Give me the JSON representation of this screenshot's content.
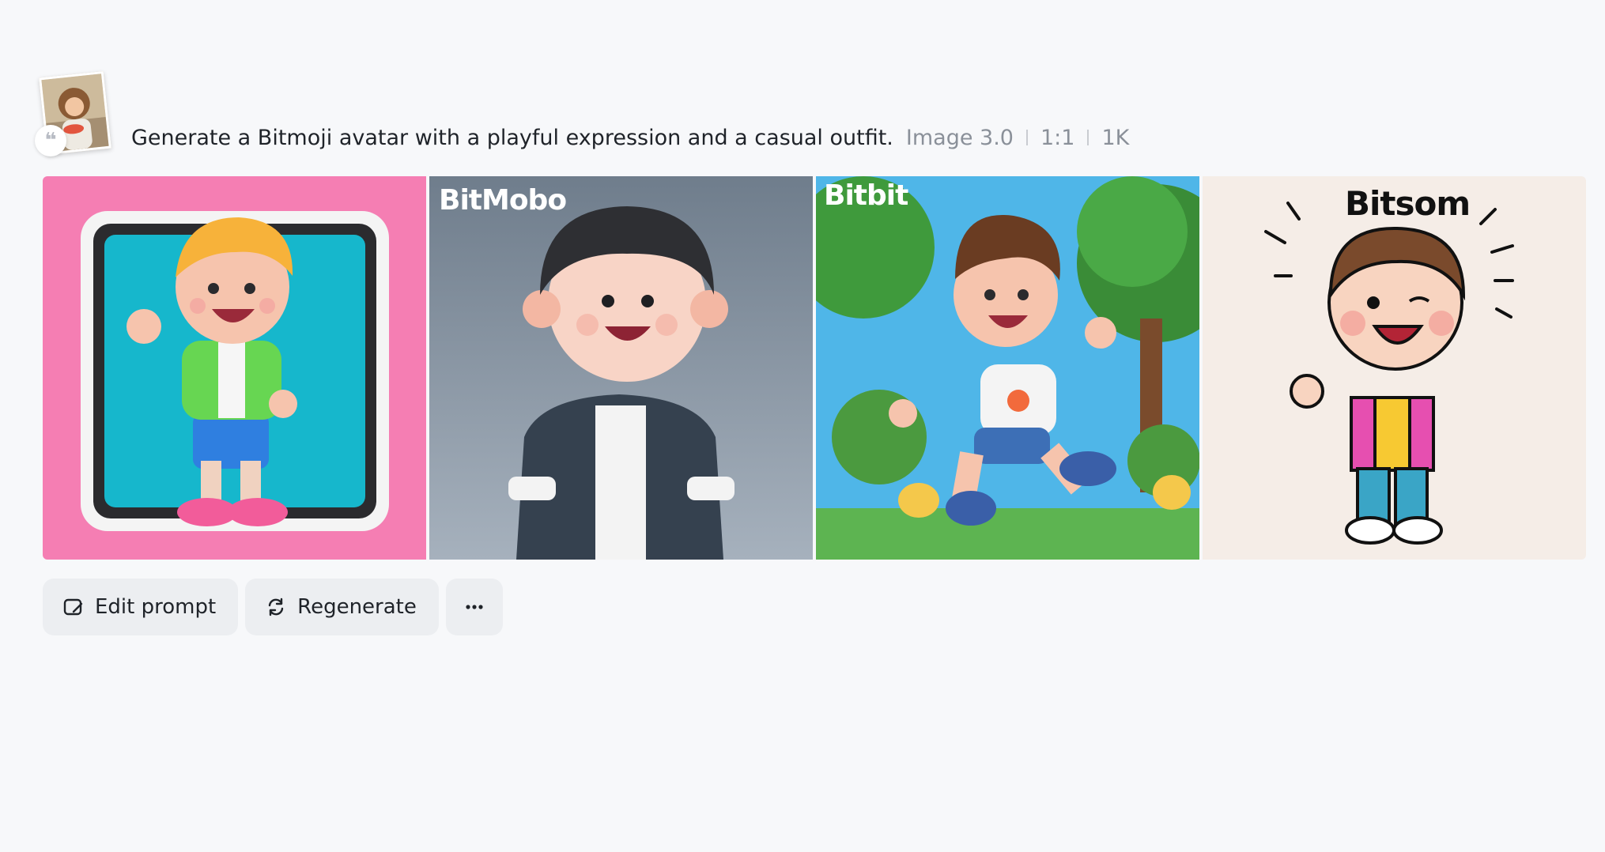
{
  "prompt": {
    "reference_image_icon": "reference-photo",
    "quote_icon": "quote-icon",
    "quote_glyph": "❝",
    "text": "Generate a Bitmoji avatar with a playful expression and a casual outfit.",
    "model": "Image 3.0",
    "ratio": "1:1",
    "resolution": "1K"
  },
  "images": [
    {
      "alt": "avatar-pink-frame",
      "background": "#f57eb3",
      "label": ""
    },
    {
      "alt": "avatar-gray-bitmobo",
      "background": "#7d8a99",
      "label": "BitMobo"
    },
    {
      "alt": "avatar-park-bitbit",
      "background": "#4fb6e8",
      "label": "Bitbit"
    },
    {
      "alt": "avatar-sketch-bitsom",
      "background": "#f5ede7",
      "label": "Bitsom"
    }
  ],
  "actions": {
    "edit_label": "Edit prompt",
    "edit_icon": "edit-icon",
    "regenerate_label": "Regenerate",
    "regenerate_icon": "refresh-icon",
    "more_icon": "more-icon"
  },
  "colors": {
    "page_bg": "#f7f8fa",
    "text_primary": "#1f2329",
    "text_meta": "#8a9099",
    "button_bg": "#eceef1"
  }
}
